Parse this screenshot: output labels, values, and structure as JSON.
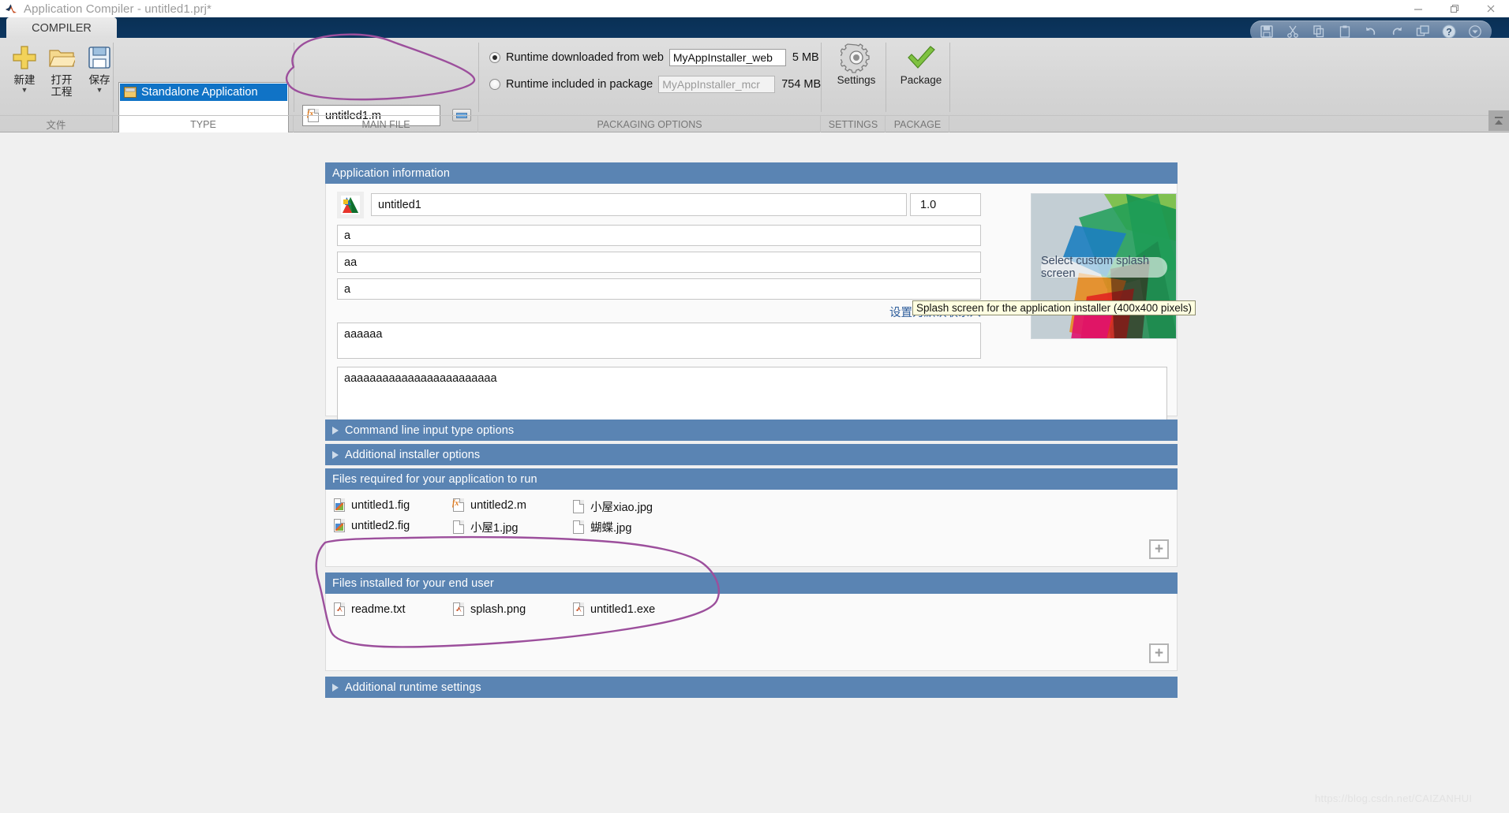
{
  "window": {
    "title": "Application Compiler - untitled1.prj*",
    "app_icon": "matlab-icon",
    "minimize": "minimize-icon",
    "maximize": "restore-icon",
    "close": "close-icon"
  },
  "quick_access": [
    {
      "name": "save-icon",
      "label": "Save"
    },
    {
      "name": "cut-icon",
      "label": "Cut"
    },
    {
      "name": "copy-icon",
      "label": "Copy"
    },
    {
      "name": "paste-icon",
      "label": "Paste"
    },
    {
      "name": "undo-icon",
      "label": "Undo"
    },
    {
      "name": "redo-icon",
      "label": "Redo"
    },
    {
      "name": "layout-icon",
      "label": "Layout"
    },
    {
      "name": "help-icon",
      "label": "Help"
    },
    {
      "name": "dropdown-icon",
      "label": "More"
    }
  ],
  "ribbon": {
    "tab": "COMPILER",
    "file_group": {
      "section_label": "文件",
      "buttons": [
        {
          "label1": "新建",
          "label2": "",
          "icon": "new-plus-icon",
          "caret": "▼"
        },
        {
          "label1": "打开",
          "label2": "工程",
          "icon": "open-folder-icon",
          "caret": ""
        },
        {
          "label1": "保存",
          "label2": "",
          "icon": "save-disk-icon",
          "caret": "▼"
        }
      ]
    },
    "type_group": {
      "section_label": "TYPE",
      "selected": "Standalone Application",
      "item_icon": "app-window-icon"
    },
    "main_file_group": {
      "section_label": "MAIN FILE",
      "file": "untitled1.m",
      "file_icon": "m-file-icon",
      "browse_button": "browse-icon"
    },
    "packaging_group": {
      "section_label": "PACKAGING OPTIONS",
      "options": [
        {
          "label": "Runtime downloaded from web",
          "value": "MyAppInstaller_web",
          "size": "5 MB",
          "selected": true,
          "enabled": true
        },
        {
          "label": "Runtime included in package",
          "value": "MyAppInstaller_mcr",
          "size": "754 MB",
          "selected": false,
          "enabled": false
        }
      ]
    },
    "settings_group": {
      "section_label": "SETTINGS",
      "button": "Settings",
      "icon": "gear-icon"
    },
    "package_group": {
      "section_label": "PACKAGE",
      "button": "Package",
      "icon": "green-check-icon"
    },
    "collapse_icon": "ribbon-collapse-icon"
  },
  "app_information": {
    "header": "Application information",
    "icon": "app-thumbnail-icon",
    "name": "untitled1",
    "version": "1.0",
    "author": "a",
    "email": "aa",
    "company": "a",
    "default_contact_link": "设置为默认联系人",
    "summary": "aaaaaa",
    "description": "aaaaaaaaaaaaaaaaaaaaaaaa",
    "splash": {
      "button": "Select custom splash screen",
      "tooltip": "Splash screen for the application installer (400x400 pixels)"
    }
  },
  "sections": {
    "command_line": "Command line input type options",
    "additional_installer": "Additional installer options",
    "additional_runtime": "Additional runtime settings"
  },
  "files_required": {
    "header": "Files required for your application to run",
    "add_button": "+",
    "items": [
      {
        "name": "untitled1.fig",
        "icon": "fig-file-icon"
      },
      {
        "name": "untitled2.m",
        "icon": "m-file-icon"
      },
      {
        "name": "小屋xiao.jpg",
        "icon": "blank-file-icon"
      },
      {
        "name": "untitled2.fig",
        "icon": "fig-file-icon"
      },
      {
        "name": "小屋1.jpg",
        "icon": "blank-file-icon"
      },
      {
        "name": "蝴蝶.jpg",
        "icon": "blank-file-icon"
      }
    ]
  },
  "files_installed": {
    "header": "Files installed for your end user",
    "add_button": "+",
    "items": [
      {
        "name": "readme.txt",
        "icon": "matlab-file-icon"
      },
      {
        "name": "splash.png",
        "icon": "matlab-file-icon"
      },
      {
        "name": "untitled1.exe",
        "icon": "matlab-file-icon"
      }
    ]
  },
  "watermark": "https://blog.csdn.net/CAIZANHUI",
  "colors": {
    "titlebar_blue": "#0d3b69",
    "panel_header": "#5a84b3",
    "selection_blue": "#1073c6",
    "link_blue": "#2c5c9a",
    "ink_purple": "#9c4f9c"
  }
}
